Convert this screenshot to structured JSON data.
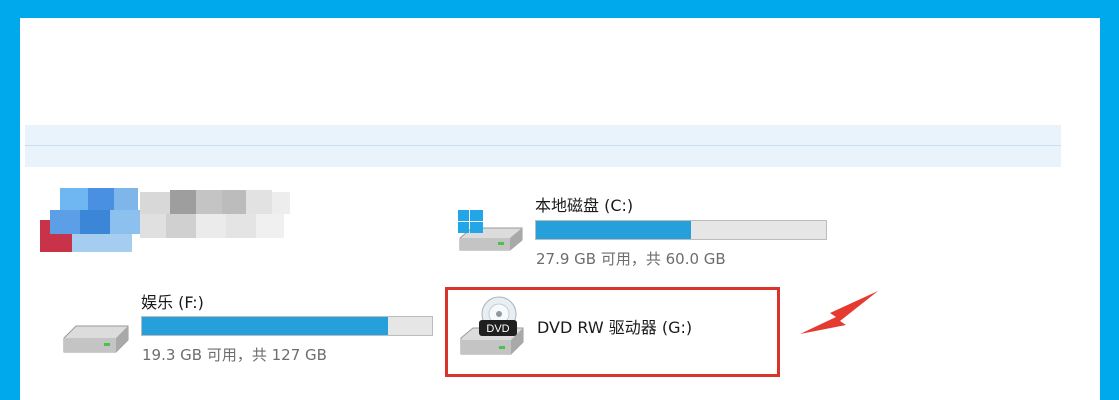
{
  "drives": [
    {
      "name": "本地磁盘 (C:)",
      "usage_fraction": 0.535,
      "size_text": "27.9 GB 可用，共 60.0 GB",
      "icon": "windows-system-drive-icon"
    },
    {
      "name": "娱乐 (F:)",
      "usage_fraction": 0.848,
      "size_text": "19.3 GB 可用，共 127 GB",
      "icon": "hard-drive-icon"
    },
    {
      "name": "DVD RW 驱动器 (G:)",
      "icon": "dvd-drive-icon",
      "dvd_badge": "DVD"
    }
  ],
  "colors": {
    "accent": "#00a8ec",
    "usage_bar": "#26a0da",
    "highlight": "#d9332b"
  }
}
